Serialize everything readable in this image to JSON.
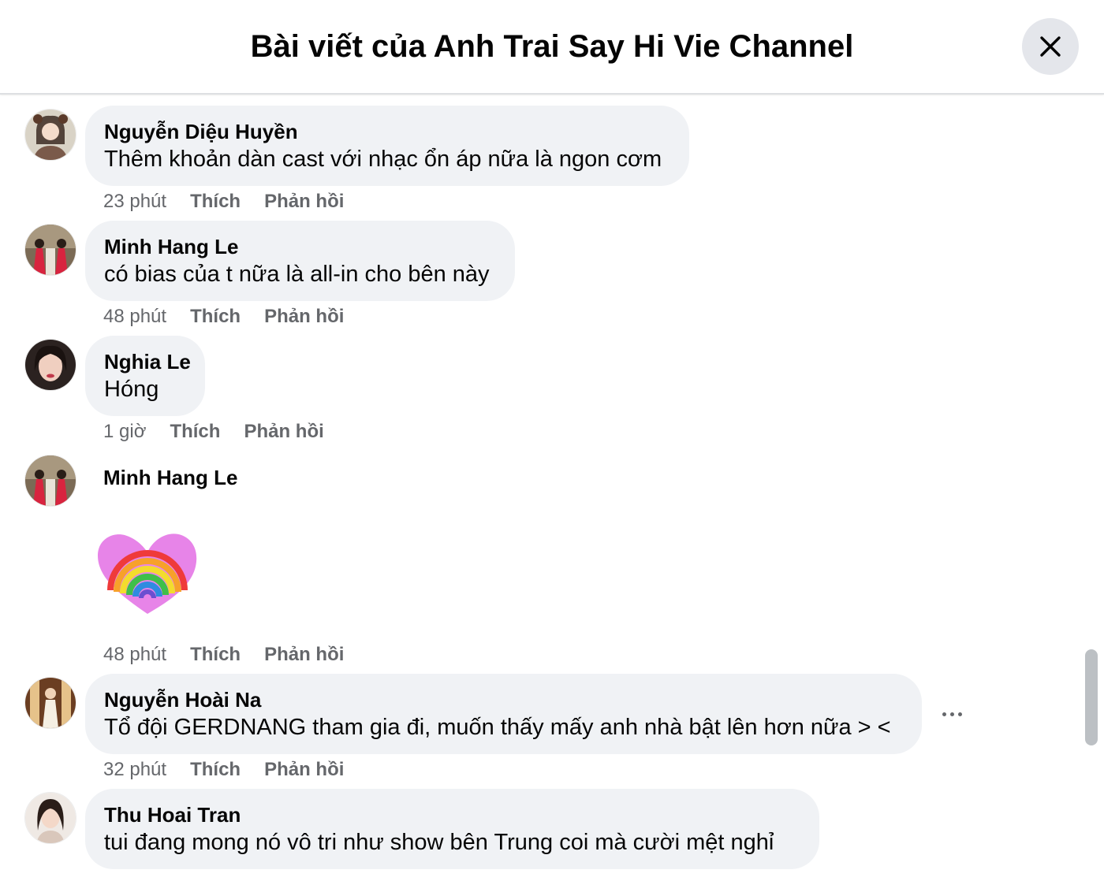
{
  "header": {
    "title": "Bài viết của Anh Trai Say Hi Vie Channel"
  },
  "actions_labels": {
    "like": "Thích",
    "reply": "Phản hồi"
  },
  "comments": [
    {
      "author": "Nguyễn Diệu Huyền",
      "text": "Thêm khoản dàn cast với nhạc ổn áp nữa là ngon cơm",
      "time": "23 phút"
    },
    {
      "author": "Minh Hang Le",
      "text": "có bias của t nữa là all-in cho bên này",
      "time": "48 phút"
    },
    {
      "author": "Nghia Le",
      "text": "Hóng",
      "time": "1 giờ"
    },
    {
      "author": "Minh Hang Le",
      "sticker": "rainbow-heart-sticker",
      "time": "48 phút"
    },
    {
      "author": "Nguyễn Hoài Na",
      "text": "Tổ đội GERDNANG tham gia đi, muốn thấy mấy anh nhà bật lên hơn nữa > <",
      "time": "32 phút"
    },
    {
      "author": "Thu Hoai Tran",
      "text": "tui đang mong nó vô tri như show bên Trung coi mà cười mệt nghỉ"
    }
  ],
  "colors": {
    "bubble": "#f0f2f5",
    "meta": "#65676b",
    "text": "#050505",
    "close_bg": "#e4e6eb"
  }
}
